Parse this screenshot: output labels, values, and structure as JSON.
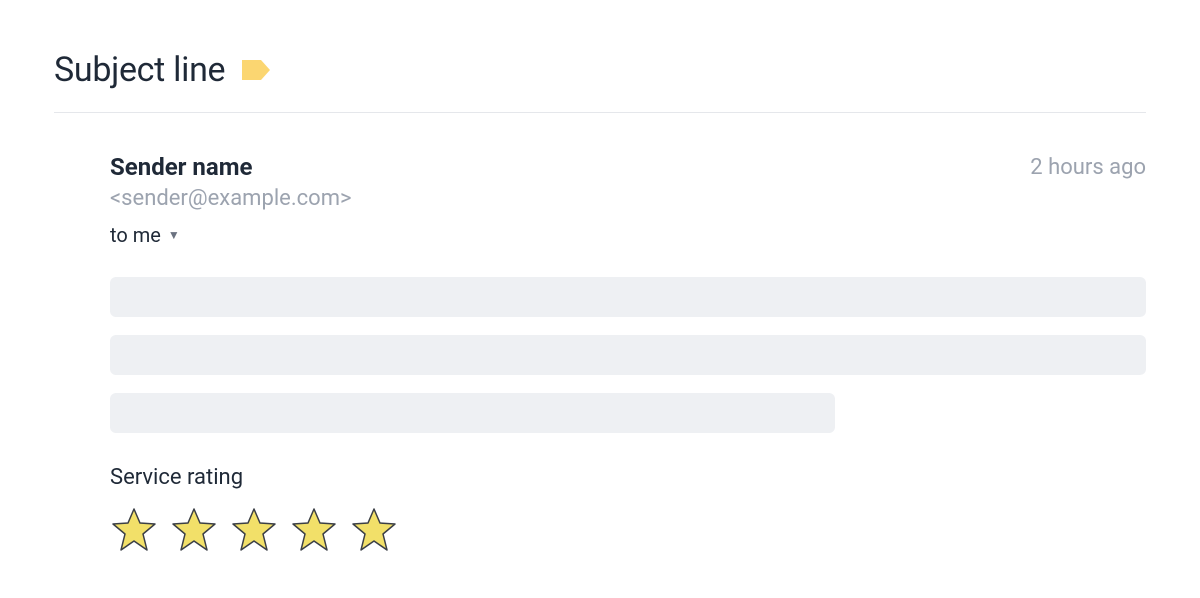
{
  "subject": {
    "title": "Subject line"
  },
  "message": {
    "sender_name": "Sender name",
    "sender_email": "<sender@example.com>",
    "to_line": "to me",
    "timestamp": "2 hours ago"
  },
  "rating": {
    "label": "Service rating",
    "stars": 5
  }
}
